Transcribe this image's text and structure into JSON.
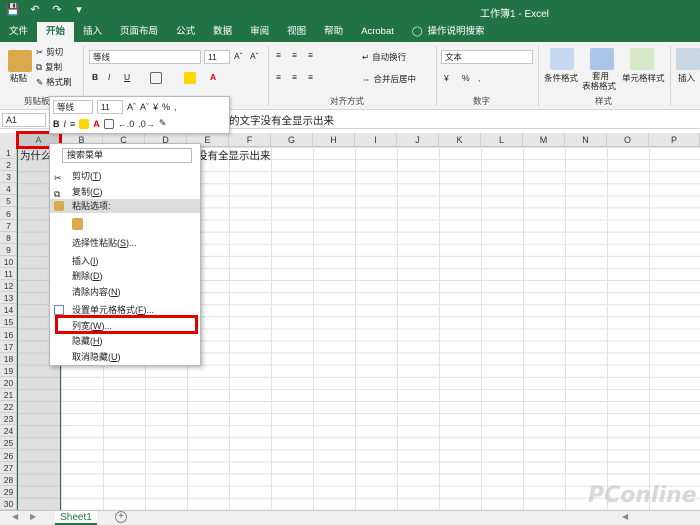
{
  "titlebar": {
    "title": "工作簿1 - Excel"
  },
  "tabs": [
    "文件",
    "开始",
    "插入",
    "页面布局",
    "公式",
    "数据",
    "审阅",
    "视图",
    "帮助",
    "Acrobat"
  ],
  "tell_me": "操作说明搜索",
  "ribbon": {
    "clipboard": {
      "paste": "粘贴",
      "cut": "剪切",
      "copy": "复制",
      "format_painter": "格式刷",
      "label": "剪贴板"
    },
    "font": {
      "name": "等线",
      "size": "11"
    },
    "alignment": {
      "wrap": "自动换行",
      "merge": "合并后居中",
      "label": "对齐方式"
    },
    "number": {
      "format": "文本",
      "label": "数字"
    },
    "styles": {
      "cond": "条件格式",
      "table1": "套用",
      "table2": "表格格式",
      "cell": "单元格样式",
      "label": "样式"
    },
    "cells": {
      "insert": "插入"
    }
  },
  "formula_bar": {
    "name_box": "A1",
    "content": "的文字没有全显示出来"
  },
  "columns": [
    "A",
    "B",
    "C",
    "D",
    "E",
    "F",
    "G",
    "H",
    "I",
    "J",
    "K",
    "L",
    "M",
    "N",
    "O",
    "P"
  ],
  "rows": [
    "1",
    "2",
    "3",
    "4",
    "5",
    "6",
    "7",
    "8",
    "9",
    "10",
    "11",
    "12",
    "13",
    "14",
    "15",
    "16",
    "17",
    "18",
    "19",
    "20",
    "21",
    "22",
    "23",
    "24",
    "25",
    "26",
    "27",
    "28",
    "29",
    "30"
  ],
  "cell_a1": {
    "left": "为什么:",
    "right": "没有全显示出来"
  },
  "mini_toolbar": {
    "font": "等线",
    "size": "11",
    "bold": "B",
    "italic": "I",
    "percent": "%"
  },
  "context_menu": {
    "search": "搜索菜单",
    "items": [
      {
        "label": "剪切(",
        "key": "T",
        "end": ")"
      },
      {
        "label": "复制(",
        "key": "C",
        "end": ")"
      },
      {
        "label": "粘贴选项:",
        "key": "",
        "end": ""
      },
      {
        "label": "选择性粘贴(",
        "key": "S",
        "end": ")..."
      },
      {
        "label": "插入(",
        "key": "I",
        "end": ")"
      },
      {
        "label": "删除(",
        "key": "D",
        "end": ")"
      },
      {
        "label": "清除内容(",
        "key": "N",
        "end": ")"
      },
      {
        "label": "设置单元格格式(",
        "key": "F",
        "end": ")..."
      },
      {
        "label": "列宽(",
        "key": "W",
        "end": ")..."
      },
      {
        "label": "隐藏(",
        "key": "H",
        "end": ")"
      },
      {
        "label": "取消隐藏(",
        "key": "U",
        "end": ")"
      }
    ]
  },
  "sheet": {
    "tab": "Sheet1"
  },
  "watermark": "PConline",
  "colors": {
    "excel_green": "#217346",
    "highlight_red": "#e00000"
  }
}
